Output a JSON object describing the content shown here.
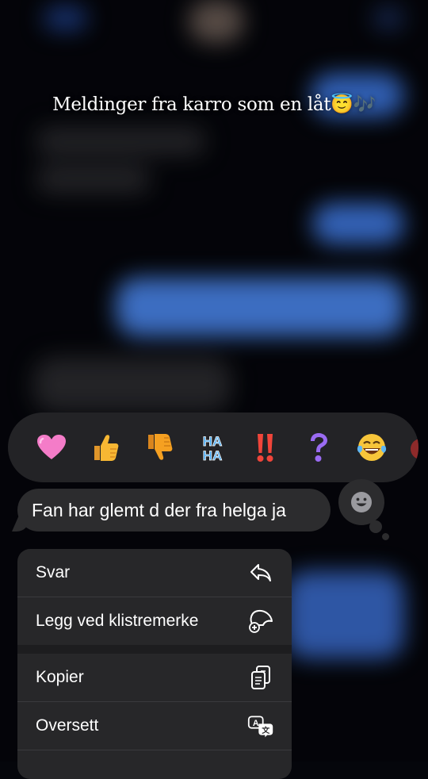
{
  "overlay_caption": "Meldinger fra karro som en låt😇🎶",
  "reactions": [
    {
      "name": "heart",
      "icon": "heart-icon",
      "color": "#f472c7"
    },
    {
      "name": "thumbs-up",
      "icon": "thumbs-up-icon",
      "color": "#f5b234"
    },
    {
      "name": "thumbs-down",
      "icon": "thumbs-down-icon",
      "color": "#f59a1f"
    },
    {
      "name": "haha",
      "icon": "haha-icon",
      "text_top": "HA",
      "text_bottom": "HA",
      "color": "#3da8f5"
    },
    {
      "name": "exclamation",
      "icon": "double-exclamation-icon",
      "color": "#f0453a"
    },
    {
      "name": "question",
      "icon": "question-icon",
      "color": "#9b6cf2"
    },
    {
      "name": "laugh-cry",
      "icon": "laughing-tears-icon",
      "color": "#f7c53a"
    }
  ],
  "message": {
    "text": "Fan har glemt d der fra helga ja",
    "bubble_color": "#2c2c2e"
  },
  "emoji_picker_icon": "smiley-icon",
  "context_menu": {
    "items": [
      {
        "label": "Svar",
        "icon": "reply-icon"
      },
      {
        "label": "Legg ved klistremerke",
        "icon": "add-sticker-icon"
      },
      {
        "label": "Kopier",
        "icon": "copy-icon"
      },
      {
        "label": "Oversett",
        "icon": "translate-icon"
      }
    ]
  },
  "colors": {
    "background": "#05060b",
    "panel": "#272729",
    "accent_blue": "#4a86ec"
  }
}
